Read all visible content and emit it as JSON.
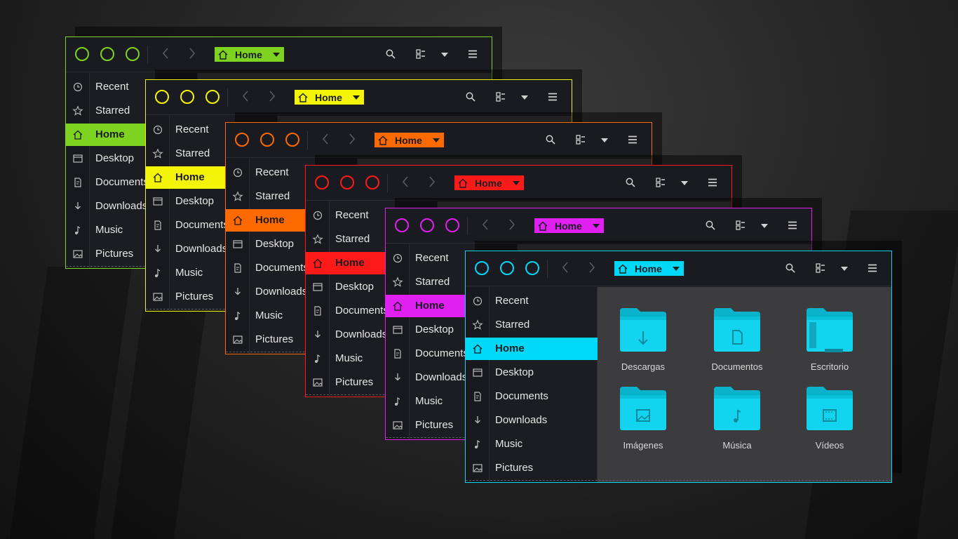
{
  "theme_colors": [
    "#7ed321",
    "#f4f408",
    "#ff6a00",
    "#ff1a1a",
    "#e020f0",
    "#00d8f8"
  ],
  "window": {
    "path_label": "Home",
    "icons": {
      "close": "circle-outline-icon",
      "back": "chevron-left-icon",
      "forward": "chevron-right-icon",
      "search": "search-icon",
      "view": "list-view-icon",
      "options": "caret-down-icon",
      "menu": "hamburger-menu-icon"
    }
  },
  "sidebar": {
    "items": [
      {
        "label": "Recent",
        "icon": "clock-icon"
      },
      {
        "label": "Starred",
        "icon": "star-icon"
      },
      {
        "label": "Home",
        "icon": "home-icon",
        "active": true
      },
      {
        "label": "Desktop",
        "icon": "desktop-icon"
      },
      {
        "label": "Documents",
        "icon": "document-icon"
      },
      {
        "label": "Downloads",
        "icon": "download-icon"
      },
      {
        "label": "Music",
        "icon": "music-icon"
      },
      {
        "label": "Pictures",
        "icon": "picture-icon"
      }
    ]
  },
  "content": {
    "folders": [
      {
        "label": "Descargas",
        "icon": "download-folder-icon"
      },
      {
        "label": "Documentos",
        "icon": "documents-folder-icon"
      },
      {
        "label": "Escritorio",
        "icon": "desktop-folder-icon"
      },
      {
        "label": "Imágenes",
        "icon": "pictures-folder-icon"
      },
      {
        "label": "Música",
        "icon": "music-folder-icon"
      },
      {
        "label": "Vídeos",
        "icon": "videos-folder-icon"
      }
    ]
  }
}
